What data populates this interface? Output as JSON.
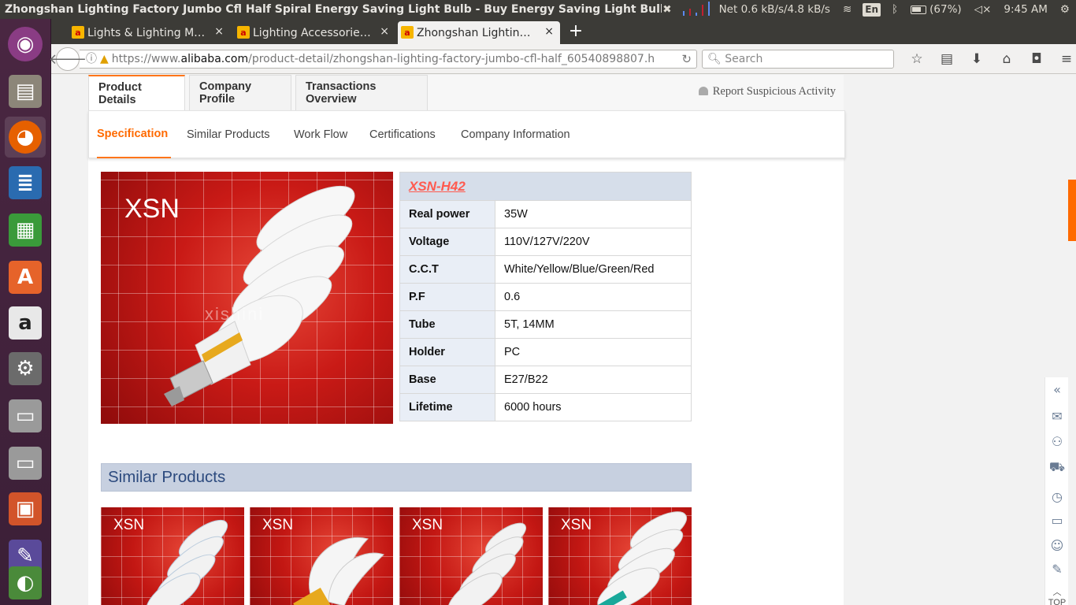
{
  "window": {
    "title": "Zhongshan Lighting Factory Jumbo Cfl Half Spiral Energy Saving Light Bulb - Buy Energy Saving Light Bulb,Energy Sa"
  },
  "indicators": {
    "net": "Net 0.6 kB/s/4.8 kB/s",
    "keyboard": "En",
    "battery": "(67%)",
    "clock": "9:45 AM"
  },
  "tabs": [
    {
      "label": "Lights & Lighting M…",
      "close": "×"
    },
    {
      "label": "Lighting Accessorie…",
      "close": "×"
    },
    {
      "label": "Zhongshan Lightin…",
      "close": "×"
    }
  ],
  "newtab": "+",
  "nav": {
    "url_prefix": "https://www.",
    "url_domain": "alibaba.com",
    "url_rest": "/product-detail/zhongshan-lighting-factory-jumbo-cfl-half_60540898807.h",
    "search_placeholder": "Search"
  },
  "page": {
    "top_tabs": [
      "Product Details",
      "Company Profile",
      "Transactions Overview"
    ],
    "report": "Report Suspicious Activity",
    "sub_tabs": [
      "Specification",
      "Similar Products",
      "Work Flow",
      "Certifications",
      "Company Information"
    ],
    "brand": "XSN",
    "watermark": "xishini",
    "model": "XSN-H42",
    "specs": [
      {
        "key": "Real power",
        "value": "35W"
      },
      {
        "key": "Voltage",
        "value": "110V/127V/220V"
      },
      {
        "key": "C.C.T",
        "value": "White/Yellow/Blue/Green/Red"
      },
      {
        "key": "P.F",
        "value": "0.6"
      },
      {
        "key": "Tube",
        "value": "5T, 14MM"
      },
      {
        "key": "Holder",
        "value": "PC"
      },
      {
        "key": "Base",
        "value": "E27/B22"
      },
      {
        "key": "Lifetime",
        "value": "6000 hours"
      }
    ],
    "similar_title": "Similar Products",
    "similar_brand": [
      "XSN",
      "XSN",
      "XSN",
      "XSN"
    ],
    "top_label": "TOP"
  }
}
